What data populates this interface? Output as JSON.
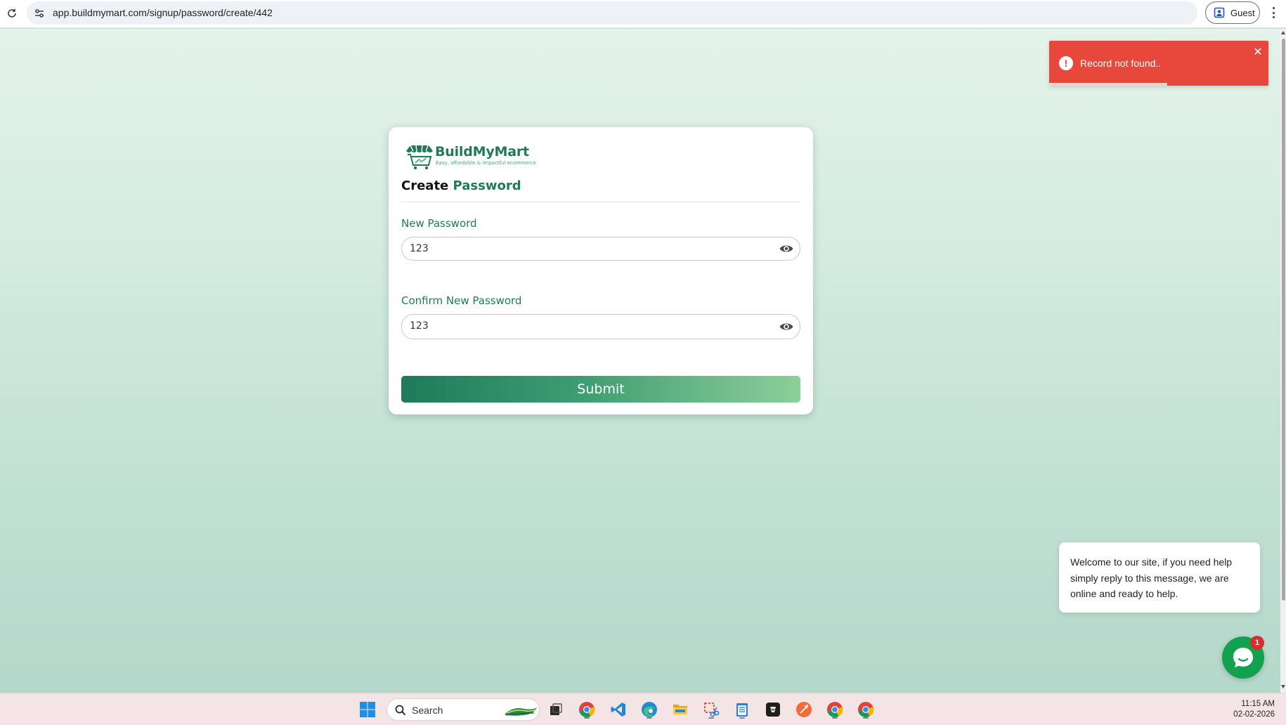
{
  "browser": {
    "url": "app.buildmymart.com/signup/password/create/442",
    "profile_label": "Guest"
  },
  "brand": {
    "name": "BuildMyMart",
    "tagline": "Easy, affordable & impactful ecommerce",
    "color": "#1f7a5a"
  },
  "form": {
    "title_part1": "Create",
    "title_part2": "Password",
    "new_password_label": "New Password",
    "new_password_value": "123",
    "confirm_password_label": "Confirm New Password",
    "confirm_password_value": "123",
    "submit_label": "Submit"
  },
  "toast": {
    "message": "Record not found..",
    "icon": "!",
    "color": "#e8483b",
    "progress_fraction": 0.54
  },
  "chat": {
    "message": "Welcome to our site, if you need help simply reply to this message, we are online and ready to help.",
    "unread_count": "1",
    "color": "#12a14f"
  },
  "taskbar": {
    "search_placeholder": "Search",
    "time": "11:15 AM",
    "date": "02-02-2026",
    "apps": [
      "start-icon",
      "task-view-icon",
      "chrome-icon",
      "vscode-icon",
      "edge-icon",
      "file-explorer-icon",
      "snipping-tool-icon",
      "notepad-icon",
      "terminal-icon",
      "postman-icon",
      "chrome-icon",
      "chrome-icon"
    ]
  }
}
